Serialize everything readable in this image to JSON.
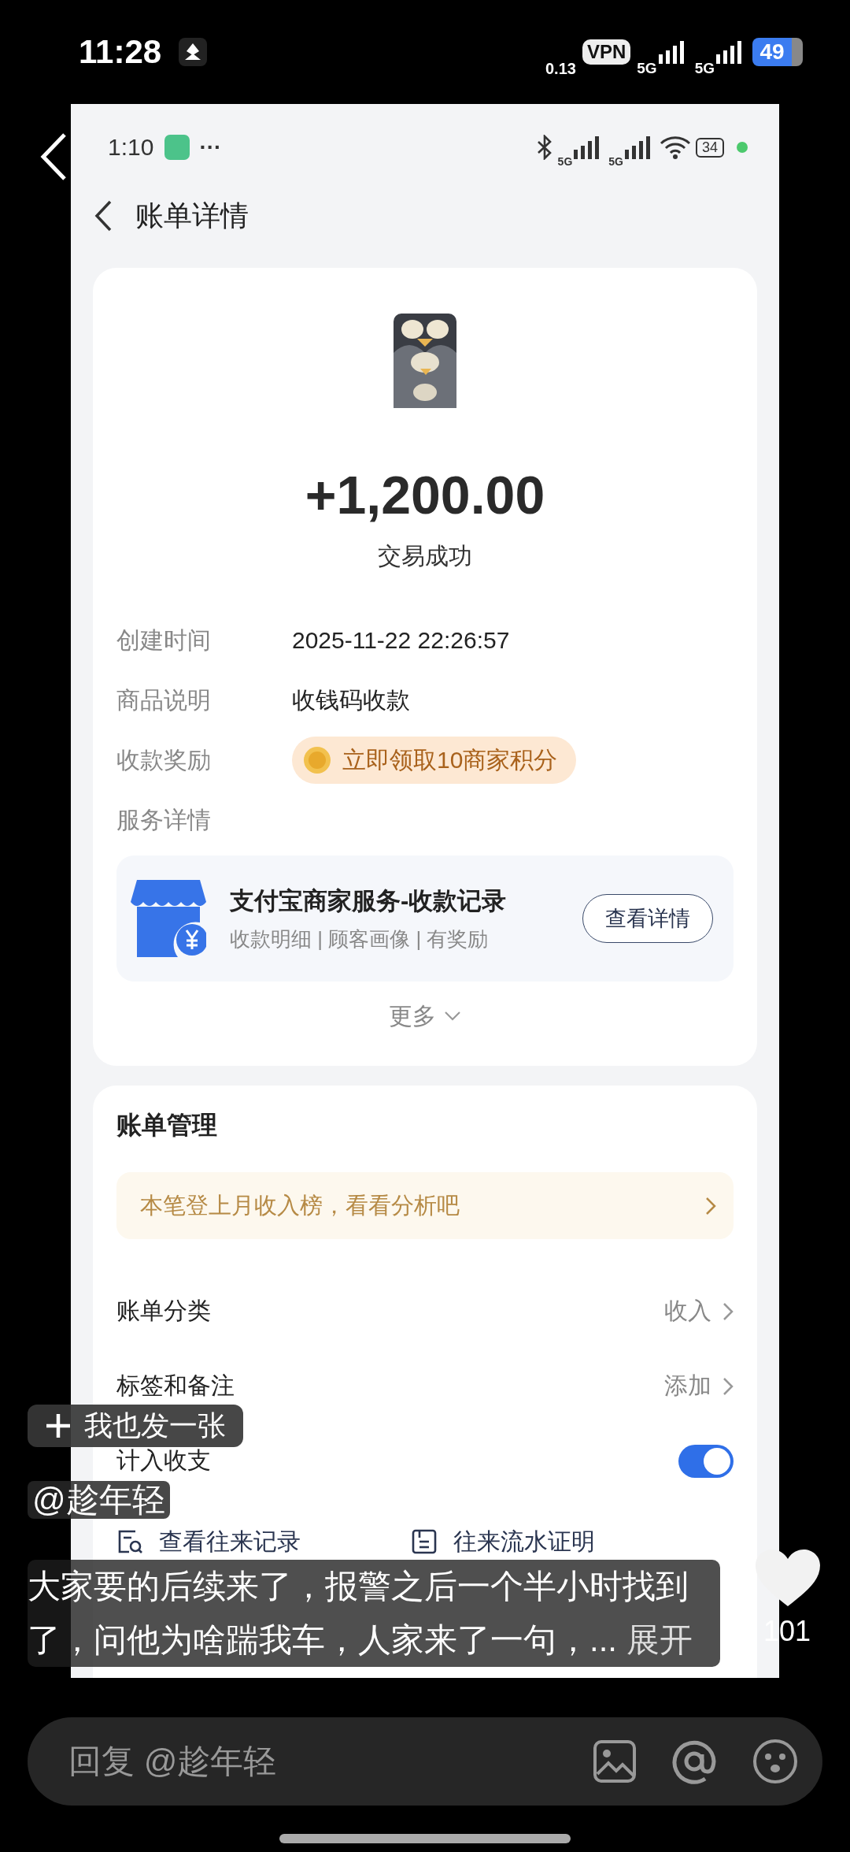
{
  "status_bar": {
    "time": "11:28",
    "net_speed": "0.13",
    "vpn": "VPN",
    "sim1": "5G",
    "sim2": "5G",
    "battery": "49"
  },
  "post_image": {
    "status_bar": {
      "time": "1:10",
      "more": "···",
      "sim1": "5G",
      "sim2": "5G",
      "battery": "34"
    },
    "title": "账单详情",
    "amount": "+1,200.00",
    "result": "交易成功",
    "details": [
      {
        "kind": "text",
        "label": "创建时间",
        "value": "2025-11-22 22:26:57"
      },
      {
        "kind": "text",
        "label": "商品说明",
        "value": "收钱码收款"
      },
      {
        "kind": "reward",
        "label": "收款奖励",
        "value": "立即领取10商家积分"
      }
    ],
    "service_label": "服务详情",
    "service": {
      "title": "支付宝商家服务-收款记录",
      "subtitle": "收款明细 | 顾客画像 | 有奖励",
      "button": "查看详情"
    },
    "more": "更多",
    "management": {
      "title": "账单管理",
      "banner": "本笔登上月收入榜，看看分析吧",
      "rows": [
        {
          "kind": "link",
          "label": "账单分类",
          "value": "收入"
        },
        {
          "kind": "link",
          "label": "标签和备注",
          "value": "添加"
        },
        {
          "kind": "toggle",
          "label": "计入收支",
          "on": true
        }
      ],
      "actions": [
        {
          "kind": "records",
          "label": "查看往来记录"
        },
        {
          "kind": "statement",
          "label": "往来流水证明"
        }
      ]
    }
  },
  "post_button": "我也发一张",
  "author": "@趁年轻",
  "caption": "大家要的后续来了，报警之后一个半小时找到了，问他为啥踹我车，人家来了一句，...",
  "expand": "展开",
  "likes": "101",
  "reply": {
    "placeholder": "回复 @趁年轻"
  }
}
